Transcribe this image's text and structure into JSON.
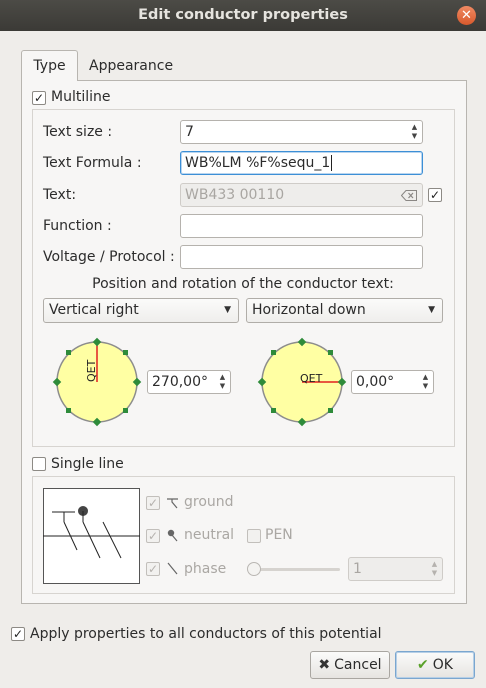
{
  "window": {
    "title": "Edit conductor properties"
  },
  "tabs": [
    {
      "label": "Type"
    },
    {
      "label": "Appearance"
    }
  ],
  "multiline": {
    "label": "Multiline",
    "checked": true,
    "text_size_label": "Text size :",
    "text_size_value": "7",
    "formula_label": "Text Formula :",
    "formula_value": "WB%LM %F%sequ_1",
    "text_label": "Text:",
    "text_value": "WB433 00110",
    "function_label": "Function :",
    "function_value": "",
    "voltage_label": "Voltage / Protocol :",
    "voltage_value": "",
    "position_heading": "Position and rotation of the conductor text:",
    "vertical_combo": "Vertical right",
    "horizontal_combo": "Horizontal down",
    "dial_text": "QET",
    "vertical_angle": "270,00°",
    "horizontal_angle": "0,00°"
  },
  "singleline": {
    "label": "Single line",
    "ground_label": "ground",
    "neutral_label": "neutral",
    "pen_label": "PEN",
    "phase_label": "phase",
    "phase_count": "1"
  },
  "footer": {
    "apply_label": "Apply properties to all conductors of this potential",
    "cancel_label": "Cancel",
    "ok_label": "OK"
  },
  "colors": {
    "dial_fill": "#ffffa3",
    "dial_marker": "#2e8b3a",
    "dial_needle": "#e02020",
    "accent": "#3c8fd6"
  },
  "icons": {
    "close": "close-icon",
    "clear": "clear-text-icon",
    "cancel": "cancel-x-icon",
    "ok": "ok-check-icon"
  }
}
